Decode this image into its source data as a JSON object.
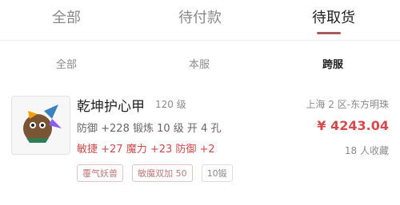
{
  "tabs": [
    "全部",
    "待付款",
    "待取货"
  ],
  "subtabs": [
    "全部",
    "本服",
    "跨服"
  ],
  "item": {
    "name": "乾坤护心甲",
    "level": "120 级",
    "server": "上海 2 区-东方明珠",
    "line1": "防御 +228  锻炼 10 级  开 4 孔",
    "line2": "敏捷 +27  魔力 +23  防御 +2",
    "price": "¥ 4243.04",
    "collect": "18 人收藏",
    "tags": [
      "覆气妖兽",
      "敏魔双加 50",
      "10锻"
    ]
  },
  "colors": {
    "accent": "#a85b5b",
    "price": "#d84a4a",
    "attr_red": "#d04a4a"
  }
}
